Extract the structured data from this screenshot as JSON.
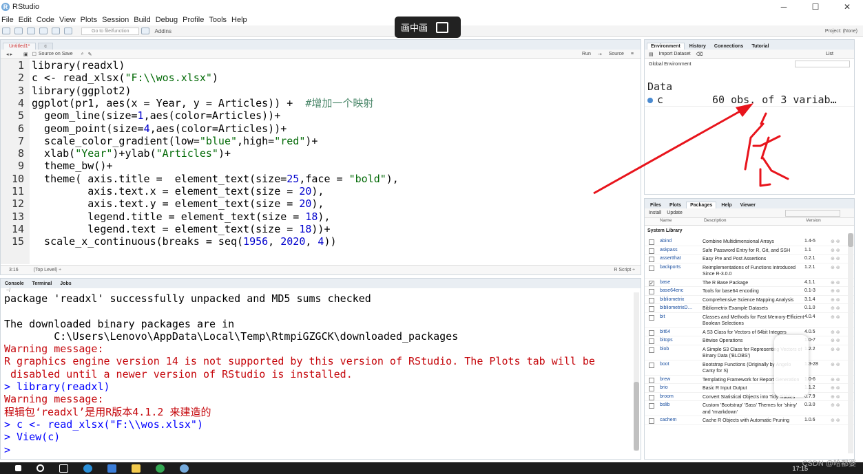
{
  "window": {
    "title": "RStudio",
    "min_label": "─",
    "max_label": "☐",
    "close_label": "✕"
  },
  "menu": [
    "File",
    "Edit",
    "Code",
    "View",
    "Plots",
    "Session",
    "Build",
    "Debug",
    "Profile",
    "Tools",
    "Help"
  ],
  "toolbar": {
    "goto_placeholder": "Go to file/function",
    "addins_label": "Addins",
    "project_label": "Project: (None)"
  },
  "pip_overlay": {
    "label": "画中画"
  },
  "source": {
    "tabs": [
      "Untitled1*",
      "c"
    ],
    "source_on_save": "Source on Save",
    "run_label": "Run",
    "source_label": "Source",
    "lines": [
      [
        {
          "t": "library(readxl)",
          "c": ""
        }
      ],
      [
        {
          "t": "c <- read_xlsx(",
          "c": ""
        },
        {
          "t": "\"F:\\\\wos.xlsx\"",
          "c": "str"
        },
        {
          "t": ")",
          "c": ""
        }
      ],
      [
        {
          "t": "library(ggplot2)",
          "c": ""
        }
      ],
      [
        {
          "t": "ggplot(pr1, aes(x = Year, y = Articles)) +  ",
          "c": ""
        },
        {
          "t": "#增加一个映射",
          "c": "cmt"
        }
      ],
      [
        {
          "t": "  geom_line(size=",
          "c": ""
        },
        {
          "t": "1",
          "c": "num"
        },
        {
          "t": ",aes(color=Articles))+",
          "c": ""
        }
      ],
      [
        {
          "t": "  geom_point(size=",
          "c": ""
        },
        {
          "t": "4",
          "c": "num"
        },
        {
          "t": ",aes(color=Articles))+",
          "c": ""
        }
      ],
      [
        {
          "t": "  scale_color_gradient(low=",
          "c": ""
        },
        {
          "t": "\"blue\"",
          "c": "str"
        },
        {
          "t": ",high=",
          "c": ""
        },
        {
          "t": "\"red\"",
          "c": "str"
        },
        {
          "t": ")+",
          "c": ""
        }
      ],
      [
        {
          "t": "  xlab(",
          "c": ""
        },
        {
          "t": "\"Year\"",
          "c": "str"
        },
        {
          "t": ")+ylab(",
          "c": ""
        },
        {
          "t": "\"Articles\"",
          "c": "str"
        },
        {
          "t": ")+",
          "c": ""
        }
      ],
      [
        {
          "t": "  theme_bw()+",
          "c": ""
        }
      ],
      [
        {
          "t": "  theme( axis.title =  element_text(size=",
          "c": ""
        },
        {
          "t": "25",
          "c": "num"
        },
        {
          "t": ",face = ",
          "c": ""
        },
        {
          "t": "\"bold\"",
          "c": "str"
        },
        {
          "t": "),",
          "c": ""
        }
      ],
      [
        {
          "t": "         axis.text.x = element_text(size = ",
          "c": ""
        },
        {
          "t": "20",
          "c": "num"
        },
        {
          "t": "),",
          "c": ""
        }
      ],
      [
        {
          "t": "         axis.text.y = element_text(size = ",
          "c": ""
        },
        {
          "t": "20",
          "c": "num"
        },
        {
          "t": "),",
          "c": ""
        }
      ],
      [
        {
          "t": "         legend.title = element_text(size = ",
          "c": ""
        },
        {
          "t": "18",
          "c": "num"
        },
        {
          "t": "),",
          "c": ""
        }
      ],
      [
        {
          "t": "         legend.text = element_text(size = ",
          "c": ""
        },
        {
          "t": "18",
          "c": "num"
        },
        {
          "t": "))+",
          "c": ""
        }
      ],
      [
        {
          "t": "  scale_x_continuous(breaks = seq(",
          "c": ""
        },
        {
          "t": "1956",
          "c": "num"
        },
        {
          "t": ", ",
          "c": ""
        },
        {
          "t": "2020",
          "c": "num"
        },
        {
          "t": ", ",
          "c": ""
        },
        {
          "t": "4",
          "c": "num"
        },
        {
          "t": "))",
          "c": ""
        }
      ]
    ],
    "cursor_pos": "3:16",
    "scope": "(Top Level) ÷",
    "language": "R Script ÷"
  },
  "console": {
    "tabs": [
      "Console",
      "Terminal",
      "Jobs"
    ],
    "path": "~/",
    "lines": [
      {
        "t": "package 'readxl' successfully unpacked and MD5 sums checked",
        "c": "black"
      },
      {
        "t": "",
        "c": "black"
      },
      {
        "t": "The downloaded binary packages are in",
        "c": "black"
      },
      {
        "t": "        C:\\Users\\Lenovo\\AppData\\Local\\Temp\\RtmpiGZGCK\\downloaded_packages",
        "c": "black"
      },
      {
        "t": "Warning message:",
        "c": "red"
      },
      {
        "t": "R graphics engine version 14 is not supported by this version of RStudio. The Plots tab will be",
        "c": "red"
      },
      {
        "t": " disabled until a newer version of RStudio is installed.",
        "c": "red"
      },
      {
        "t": "> library(readxl)",
        "c": "blue"
      },
      {
        "t": "Warning message:",
        "c": "red"
      },
      {
        "t": "程辑包‘readxl’是用R版本4.1.2 来建造的",
        "c": "red"
      },
      {
        "t": "> c <- read_xlsx(\"F:\\\\wos.xlsx\")",
        "c": "blue"
      },
      {
        "t": "> View(c)",
        "c": "blue"
      },
      {
        "t": "> ",
        "c": "blue"
      }
    ]
  },
  "environment": {
    "tabs": [
      "Environment",
      "History",
      "Connections",
      "Tutorial"
    ],
    "import_label": "Import Dataset",
    "list_label": "List",
    "scope": "Global Environment",
    "section": "Data",
    "objects": [
      {
        "name": "c",
        "value": "60 obs. of 3 variab…"
      }
    ]
  },
  "files": {
    "tabs": [
      "Files",
      "Plots",
      "Packages",
      "Help",
      "Viewer"
    ],
    "install_label": "Install",
    "update_label": "Update",
    "headers": [
      "Name",
      "Description",
      "Version"
    ],
    "section": "System Library",
    "packages": [
      {
        "name": "abind",
        "desc": "Combine Multidimensional Arrays",
        "ver": "1.4-5",
        "checked": false
      },
      {
        "name": "askpass",
        "desc": "Safe Password Entry for R, Git, and SSH",
        "ver": "1.1",
        "checked": false
      },
      {
        "name": "assertthat",
        "desc": "Easy Pre and Post Assertions",
        "ver": "0.2.1",
        "checked": false
      },
      {
        "name": "backports",
        "desc": "Reimplementations of Functions Introduced Since R-3.0.0",
        "ver": "1.2.1",
        "checked": false
      },
      {
        "name": "base",
        "desc": "The R Base Package",
        "ver": "4.1.1",
        "checked": true
      },
      {
        "name": "base64enc",
        "desc": "Tools for base64 encoding",
        "ver": "0.1-3",
        "checked": false
      },
      {
        "name": "bibliometrix",
        "desc": "Comprehensive Science Mapping Analysis",
        "ver": "3.1.4",
        "checked": false
      },
      {
        "name": "bibliometrixD…",
        "desc": "Bibliometrix Example Datasets",
        "ver": "0.1.0",
        "checked": false
      },
      {
        "name": "bit",
        "desc": "Classes and Methods for Fast Memory-Efficient Boolean Selections",
        "ver": "4.0.4",
        "checked": false
      },
      {
        "name": "bit64",
        "desc": "A S3 Class for Vectors of 64bit Integers",
        "ver": "4.0.5",
        "checked": false
      },
      {
        "name": "bitops",
        "desc": "Bitwise Operations",
        "ver": "1.0-7",
        "checked": false
      },
      {
        "name": "blob",
        "desc": "A Simple S3 Class for Representing Vectors of Binary Data ('BLOBS')",
        "ver": "1.2.2",
        "checked": false
      },
      {
        "name": "boot",
        "desc": "Bootstrap Functions (Originally by Angelo Canty for S)",
        "ver": "1.3-28",
        "checked": false
      },
      {
        "name": "brew",
        "desc": "Templating Framework for Report Generation",
        "ver": "1.0-6",
        "checked": false
      },
      {
        "name": "brio",
        "desc": "Basic R Input Output",
        "ver": "1.1.2",
        "checked": false
      },
      {
        "name": "broom",
        "desc": "Convert Statistical Objects into Tidy Tibbles",
        "ver": "0.7.9",
        "checked": false
      },
      {
        "name": "bslib",
        "desc": "Custom 'Bootstrap' 'Sass' Themes for 'shiny' and 'rmarkdown'",
        "ver": "0.3.0",
        "checked": false
      },
      {
        "name": "cachem",
        "desc": "Cache R Objects with Automatic Pruning",
        "ver": "1.0.6",
        "checked": false
      }
    ]
  },
  "taskbar": {
    "time": "17:15"
  },
  "watermark": "CSDN @哈都婆",
  "colors": {
    "code_string": "#036a07",
    "code_number": "#0000cd",
    "console_error": "#c5060b",
    "console_input": "#0000ff",
    "annotation": "#e8141c"
  }
}
